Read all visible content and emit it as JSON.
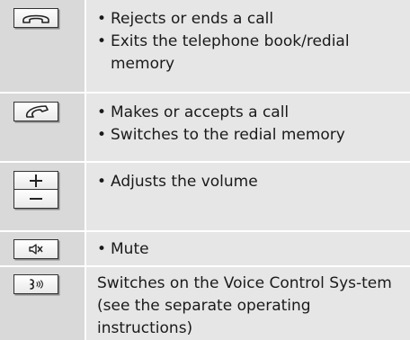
{
  "rows": [
    {
      "key_icon": "end-call-icon",
      "items": [
        "Rejects or ends a call",
        "Exits the telephone book/redial memory"
      ]
    },
    {
      "key_icon": "accept-call-icon",
      "items": [
        "Makes or accepts a call",
        "Switches to the redial memory"
      ]
    },
    {
      "key_icon": "volume-plus-minus-icon",
      "items": [
        "Adjusts the volume"
      ]
    },
    {
      "key_icon": "mute-icon",
      "items": [
        "Mute"
      ]
    },
    {
      "key_icon": "voice-control-icon",
      "text": "Switches on the Voice Control Sys-tem (see the separate operating instructions)"
    }
  ]
}
